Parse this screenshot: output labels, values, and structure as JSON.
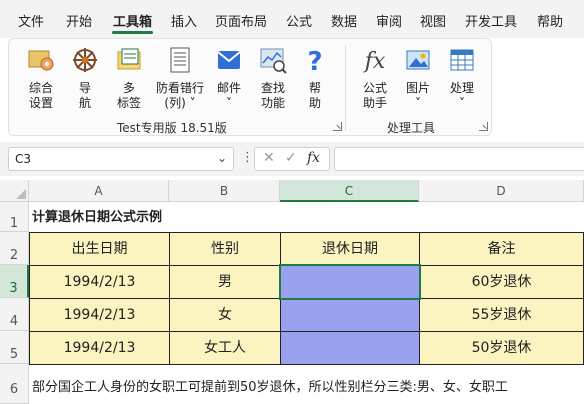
{
  "menu": {
    "items": [
      "文件",
      "开始",
      "工具箱",
      "插入",
      "页面布局",
      "公式",
      "数据",
      "审阅",
      "视图",
      "开发工具",
      "帮助"
    ],
    "active": "工具箱"
  },
  "ribbon": {
    "group1_buttons": [
      {
        "line1": "综合",
        "line2": "设置",
        "icon": "gear-settings-icon"
      },
      {
        "line1": "导",
        "line2": "航",
        "icon": "navigation-wheel-icon"
      },
      {
        "line1": "多",
        "line2": "标签",
        "icon": "multi-tab-folder-icon"
      },
      {
        "line1": "防看错行",
        "line2": "(列) ˅",
        "icon": "grid-highlight-icon"
      },
      {
        "line1": "邮件",
        "line2": "˅",
        "icon": "mail-icon"
      },
      {
        "line1": "查找",
        "line2": "功能",
        "icon": "find-icon"
      },
      {
        "line1": "帮",
        "line2": "助",
        "icon": "help-icon"
      }
    ],
    "group1_label": "Test专用版 18.51版",
    "group2_buttons": [
      {
        "line1": "公式",
        "line2": "助手",
        "icon": "formula-fx-icon"
      },
      {
        "line1": "图片",
        "line2": "˅",
        "icon": "picture-icon"
      },
      {
        "line1": "处理",
        "line2": "˅",
        "icon": "table-process-icon"
      }
    ],
    "group2_label": "处理工具"
  },
  "formula_bar": {
    "name_box": "C3",
    "formula": "",
    "cancel_symbol": "✕",
    "enter_symbol": "✓",
    "fx_symbol": "fx"
  },
  "sheet": {
    "columns": [
      "A",
      "B",
      "C",
      "D"
    ],
    "selected_column": "C",
    "rows": [
      "1",
      "2",
      "3",
      "4",
      "5",
      "6"
    ],
    "selected_row": "3",
    "title": "计算退休日期公式示例",
    "headers": [
      "出生日期",
      "性别",
      "退休日期",
      "备注"
    ],
    "data": [
      [
        "1994/2/13",
        "男",
        "",
        "60岁退休"
      ],
      [
        "1994/2/13",
        "女",
        "",
        "55岁退休"
      ],
      [
        "1994/2/13",
        "女工人",
        "",
        "50岁退休"
      ]
    ],
    "note": "部分国企工人身份的女职工可提前到50岁退休，所以性别栏分三类:男、女、女职工",
    "colors": {
      "header_fill": "#fbf3c0",
      "date_fill": "#9aa2f0",
      "accent": "#1e7b44"
    }
  }
}
